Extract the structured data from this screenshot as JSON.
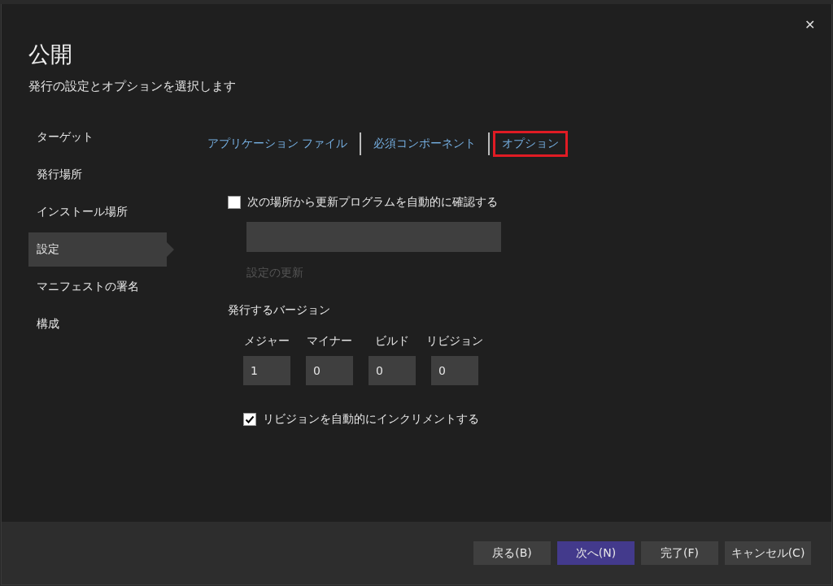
{
  "window": {
    "title": "公開",
    "subtitle": "発行の設定とオプションを選択します",
    "close": "✕"
  },
  "sidebar": {
    "items": [
      {
        "label": "ターゲット",
        "selected": false
      },
      {
        "label": "発行場所",
        "selected": false
      },
      {
        "label": "インストール場所",
        "selected": false
      },
      {
        "label": "設定",
        "selected": true
      },
      {
        "label": "マニフェストの署名",
        "selected": false
      },
      {
        "label": "構成",
        "selected": false
      }
    ]
  },
  "tabs": [
    {
      "label": "アプリケーション ファイル",
      "annotated": false
    },
    {
      "label": "必須コンポーネント",
      "annotated": false
    },
    {
      "label": "オプション",
      "annotated": true
    }
  ],
  "update_check": {
    "label": "次の場所から更新プログラムを自動的に確認する",
    "checked": false
  },
  "update_settings_button": {
    "label": "設定の更新",
    "disabled": true
  },
  "version": {
    "heading": "発行するバージョン",
    "fields": [
      {
        "label": "メジャー",
        "value": "1"
      },
      {
        "label": "マイナー",
        "value": "0"
      },
      {
        "label": "ビルド",
        "value": "0"
      },
      {
        "label": "リビジョン",
        "value": "0"
      }
    ]
  },
  "auto_increment": {
    "label": "リビジョンを自動的にインクリメントする",
    "checked": true
  },
  "buttons": [
    {
      "label": "戻る(B)",
      "kind": "normal"
    },
    {
      "label": "次へ(N)",
      "kind": "primary"
    },
    {
      "label": "完了(F)",
      "kind": "normal"
    },
    {
      "label": "キャンセル(C)",
      "kind": "normal"
    }
  ]
}
